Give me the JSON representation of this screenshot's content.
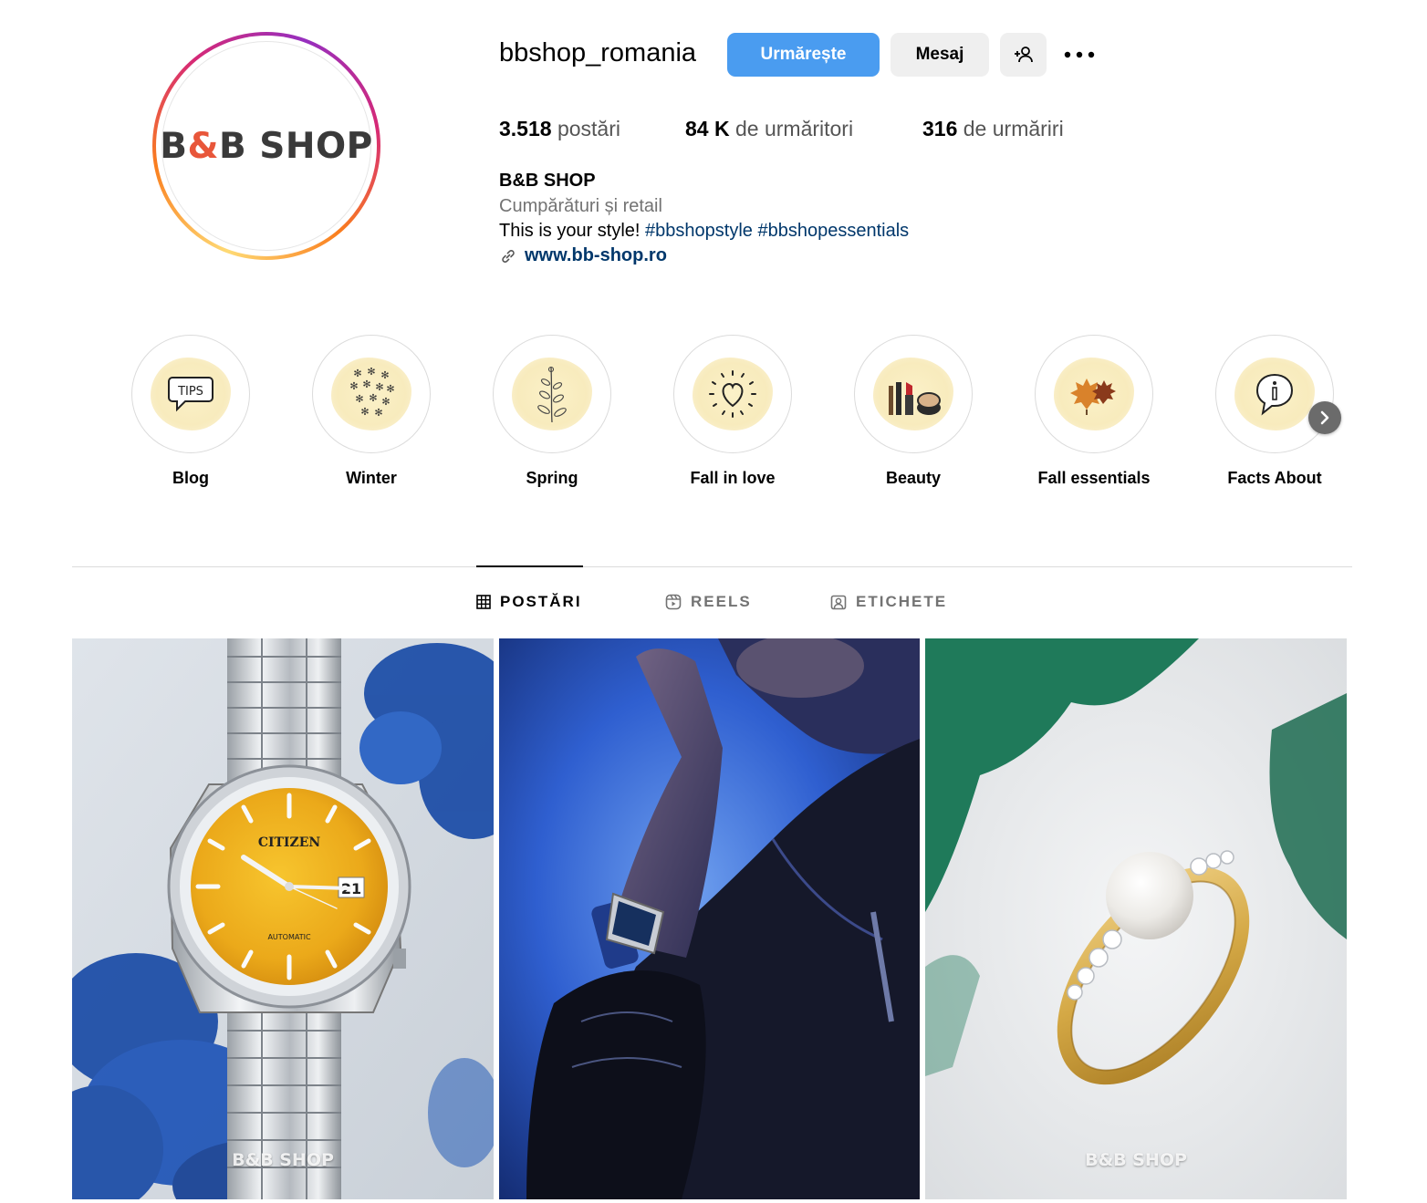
{
  "profile": {
    "username": "bbshop_romania",
    "avatar_logo_prefix": "B",
    "avatar_logo_amp": "&",
    "avatar_logo_suffix": "B SHOP"
  },
  "actions": {
    "follow_label": "Urmărește",
    "message_label": "Mesaj",
    "add_icon": "person-plus-icon",
    "more_icon": "more-horizontal-icon"
  },
  "stats": {
    "posts_value": "3.518",
    "posts_label": "postări",
    "followers_value": "84 K",
    "followers_label": "de urmăritori",
    "following_value": "316",
    "following_label": "de urmăriri"
  },
  "bio": {
    "name": "B&B SHOP",
    "category": "Cumpărături și retail",
    "text_plain": "This is your style! ",
    "hashtag_1": "#bbshopstyle",
    "hashtag_2": "#bbshopessentials",
    "link": "www.bb-shop.ro"
  },
  "highlights": [
    {
      "label": "Blog",
      "icon": "tips-bubble-icon"
    },
    {
      "label": "Winter",
      "icon": "snowflakes-icon"
    },
    {
      "label": "Spring",
      "icon": "flower-sprig-icon"
    },
    {
      "label": "Fall in love",
      "icon": "heart-icon"
    },
    {
      "label": "Beauty",
      "icon": "makeup-icon"
    },
    {
      "label": "Fall essentials",
      "icon": "autumn-leaves-icon"
    },
    {
      "label": "Facts About",
      "icon": "info-bubble-icon"
    }
  ],
  "tabs": {
    "posts": "POSTĂRI",
    "reels": "REELS",
    "tagged": "ETICHETE"
  },
  "posts": [
    {
      "watermark": "B&B SHOP",
      "subject": "yellow-dial-watch",
      "dial_brand": "CITIZEN",
      "dial_sub": "AUTOMATIC",
      "dial_date": "21"
    },
    {
      "watermark": "",
      "subject": "wrist-watch-blue"
    },
    {
      "watermark": "B&B SHOP",
      "subject": "pearl-ring"
    }
  ],
  "colors": {
    "follow_button": "#4a9cf0",
    "hashtag_link": "#00376b",
    "secondary_text": "#737373",
    "highlight_bg": "#f8ebbd",
    "logo_accent": "#e8563a"
  }
}
